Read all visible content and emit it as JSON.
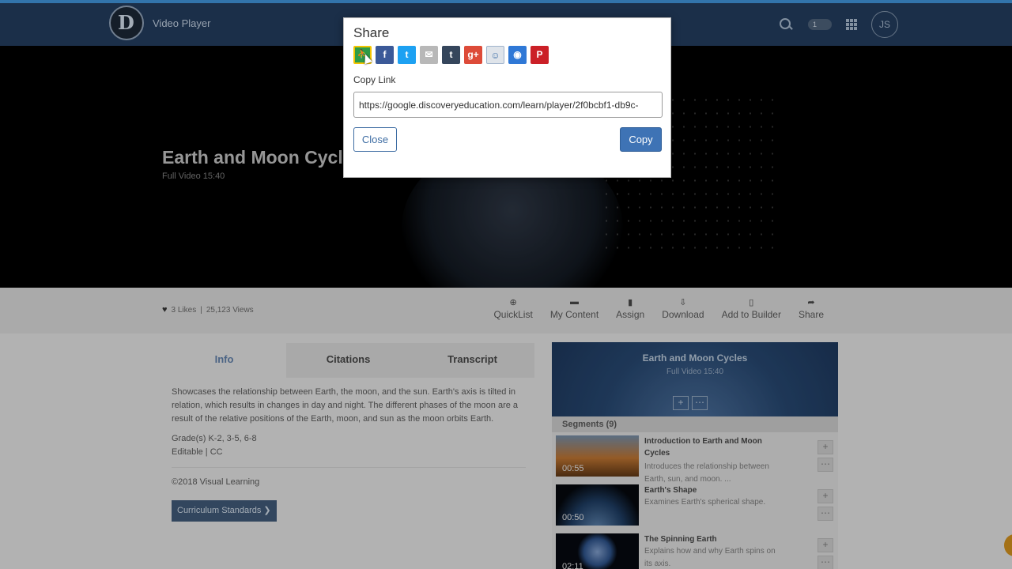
{
  "header": {
    "app_title": "Video Player",
    "list_count": "1",
    "avatar_initials": "JS"
  },
  "hero": {
    "title": "Earth and Moon Cycles",
    "subtitle": "Full Video  15:40"
  },
  "stats": {
    "likes": "3 Likes",
    "separator": "|",
    "views": "25,123 Views"
  },
  "actions": [
    {
      "label": "QuickList",
      "icon": "plus-circle-icon",
      "glyph": "⊕"
    },
    {
      "label": "My Content",
      "icon": "folder-icon",
      "glyph": "▬"
    },
    {
      "label": "Assign",
      "icon": "document-icon",
      "glyph": "▮"
    },
    {
      "label": "Download",
      "icon": "download-icon",
      "glyph": "⇩"
    },
    {
      "label": "Add to Builder",
      "icon": "page-icon",
      "glyph": "▯"
    },
    {
      "label": "Share",
      "icon": "share-icon",
      "glyph": "➦"
    }
  ],
  "tabs": {
    "info": "Info",
    "citations": "Citations",
    "transcript": "Transcript"
  },
  "info": {
    "description": "Showcases the relationship between Earth, the moon, and the sun. Earth's axis is tilted in relation, which results in changes in day and night. The different phases of the moon are a result of the relative positions of the Earth, moon, and sun as the moon orbits Earth.",
    "grades": "Grade(s) K-2, 3-5, 6-8",
    "editable": "Editable | CC",
    "copyright": "©2018 Visual Learning",
    "curriculum_button": "Curriculum Standards ❯"
  },
  "segments_panel": {
    "title": "Earth and Moon Cycles",
    "subtitle": "Full Video  15:40",
    "header": "Segments (9)",
    "items": [
      {
        "time": "00:55",
        "title": "Introduction to Earth and Moon Cycles",
        "desc": "Introduces the relationship between Earth, sun, and moon. ..."
      },
      {
        "time": "00:50",
        "title": "Earth's Shape",
        "desc": "Examines Earth's spherical shape."
      },
      {
        "time": "02:11",
        "title": "The Spinning Earth",
        "desc": "Explains how and why Earth spins on its axis."
      }
    ]
  },
  "modal": {
    "title": "Share",
    "copy_label": "Copy Link",
    "link": "https://google.discoveryeducation.com/learn/player/2f0bcbf1-db9c-",
    "close_label": "Close",
    "copy_label_btn": "Copy",
    "share_buttons": [
      {
        "name": "google-classroom-icon",
        "glyph": "⛹"
      },
      {
        "name": "facebook-icon",
        "glyph": "f"
      },
      {
        "name": "twitter-icon",
        "glyph": "t"
      },
      {
        "name": "email-icon",
        "glyph": "✉"
      },
      {
        "name": "tumblr-icon",
        "glyph": "t"
      },
      {
        "name": "google-plus-icon",
        "glyph": "g+"
      },
      {
        "name": "remind-icon",
        "glyph": "☺"
      },
      {
        "name": "messenger-icon",
        "glyph": "◉"
      },
      {
        "name": "pinterest-icon",
        "glyph": "P"
      }
    ]
  },
  "colors": {
    "accent": "#3e73b5",
    "topbar": "#223a5a",
    "tab_active": "#5b79a1"
  }
}
